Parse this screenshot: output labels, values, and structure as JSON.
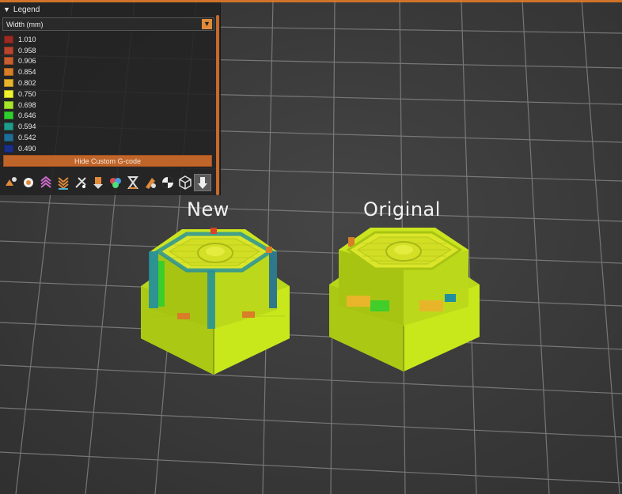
{
  "labels": {
    "new": "New",
    "original": "Original"
  },
  "legend": {
    "title": "Legend",
    "view_type": "Width (mm)",
    "entries": [
      {
        "value": "1.010",
        "color": "#9b2a22"
      },
      {
        "value": "0.958",
        "color": "#b8442c"
      },
      {
        "value": "0.906",
        "color": "#c85d2e"
      },
      {
        "value": "0.854",
        "color": "#d87d28"
      },
      {
        "value": "0.802",
        "color": "#e8b52a"
      },
      {
        "value": "0.750",
        "color": "#eff22e"
      },
      {
        "value": "0.698",
        "color": "#a6e62a"
      },
      {
        "value": "0.646",
        "color": "#2fcf2f"
      },
      {
        "value": "0.594",
        "color": "#1f9c8a"
      },
      {
        "value": "0.542",
        "color": "#1f6e98"
      },
      {
        "value": "0.490",
        "color": "#182f8c"
      }
    ],
    "hide_gcode_label": "Hide Custom G-code",
    "toolbar": [
      "travel-icon",
      "wipe-icon",
      "retractions-icon",
      "deretractions-icon",
      "seams-icon",
      "tool-changes-icon",
      "color-changes-icon",
      "pause-icon",
      "custom-gcode-icon",
      "center-of-gravity-icon",
      "shells-icon",
      "tool-marker-icon"
    ]
  },
  "colors": {
    "accent": "#c0652a",
    "viewport_bg": "#3b3b3b",
    "grid": "#8a8a8a",
    "model_main": "#c8e81c"
  }
}
